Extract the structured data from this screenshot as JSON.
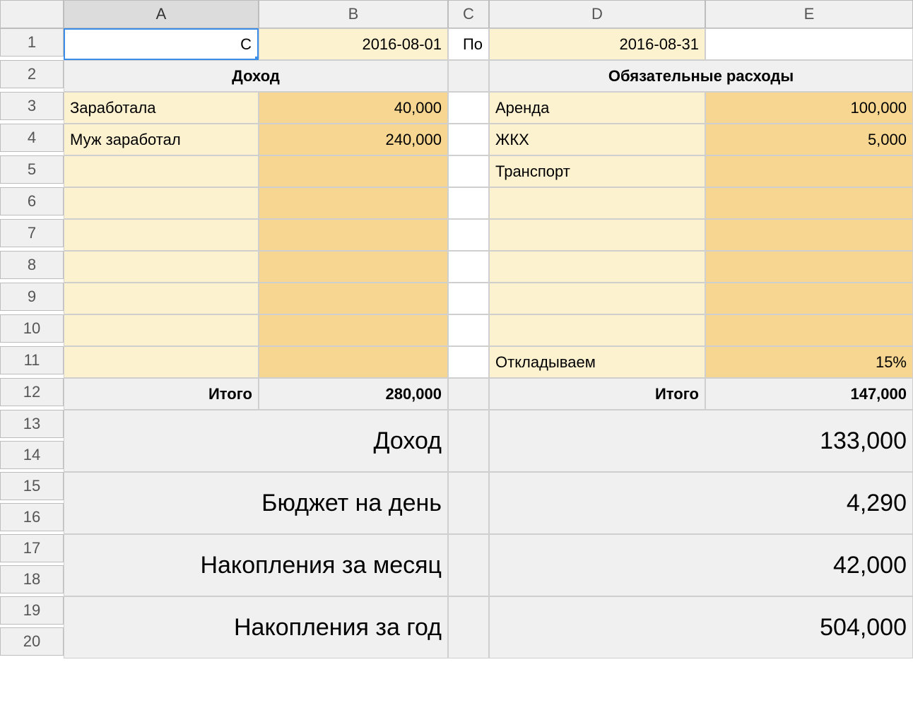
{
  "columns": [
    "A",
    "B",
    "C",
    "D",
    "E"
  ],
  "rows": [
    "1",
    "2",
    "3",
    "4",
    "5",
    "6",
    "7",
    "8",
    "9",
    "10",
    "11",
    "12",
    "13",
    "14",
    "15",
    "16",
    "17",
    "18",
    "19",
    "20"
  ],
  "r1": {
    "a": "С",
    "b": "2016-08-01",
    "c": "По",
    "d": "2016-08-31"
  },
  "r2": {
    "income_header": "Доход",
    "expense_header": "Обязательные расходы"
  },
  "income": [
    {
      "label": "Заработала",
      "value": "40,000"
    },
    {
      "label": "Муж заработал",
      "value": "240,000"
    }
  ],
  "expenses": [
    {
      "label": "Аренда",
      "value": "100,000"
    },
    {
      "label": "ЖКХ",
      "value": "5,000"
    },
    {
      "label": "Транспорт",
      "value": ""
    }
  ],
  "savings_row": {
    "label": "Откладываем",
    "value": "15%"
  },
  "totals": {
    "label": "Итого",
    "income": "280,000",
    "expense": "147,000"
  },
  "summary": [
    {
      "label": "Доход",
      "value": "133,000"
    },
    {
      "label": "Бюджет на день",
      "value": "4,290"
    },
    {
      "label": "Накопления за месяц",
      "value": "42,000"
    },
    {
      "label": "Накопления за год",
      "value": "504,000"
    }
  ]
}
